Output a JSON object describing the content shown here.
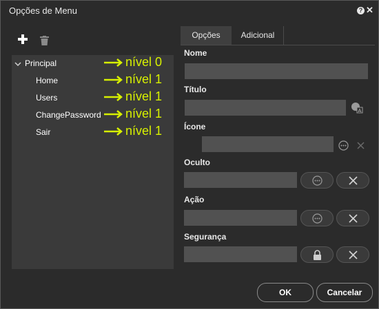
{
  "window": {
    "title": "Opções de Menu",
    "help_icon": "question-icon",
    "close_icon": "close-icon"
  },
  "toolbar": {
    "add_icon": "plus-icon",
    "delete_icon": "trash-icon"
  },
  "tree": {
    "items": [
      {
        "label": "Principal",
        "annotation": "nível 0"
      },
      {
        "label": "Home",
        "annotation": "nível 1"
      },
      {
        "label": "Users",
        "annotation": "nível 1"
      },
      {
        "label": "ChangePassword",
        "annotation": "nível 1"
      },
      {
        "label": "Sair",
        "annotation": "nível 1"
      }
    ],
    "annotation_color": "#d7f000"
  },
  "tabs": [
    {
      "label": "Opções",
      "active": true
    },
    {
      "label": "Adicional",
      "active": false
    }
  ],
  "form": {
    "nome": {
      "label": "Nome",
      "value": ""
    },
    "titulo": {
      "label": "Título",
      "value": ""
    },
    "icone": {
      "label": "Ícone",
      "value": ""
    },
    "oculto": {
      "label": "Oculto",
      "value": ""
    },
    "acao": {
      "label": "Ação",
      "value": ""
    },
    "seguranca": {
      "label": "Segurança",
      "value": ""
    }
  },
  "footer": {
    "ok_label": "OK",
    "cancel_label": "Cancelar"
  }
}
